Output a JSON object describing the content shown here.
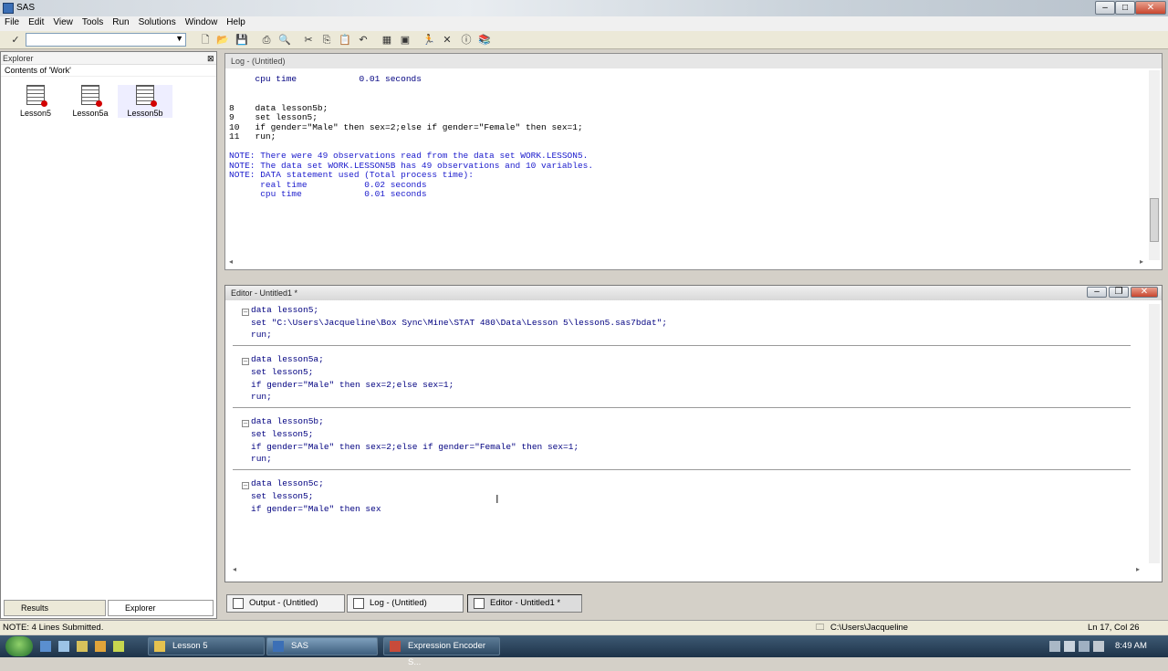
{
  "window": {
    "title": "SAS"
  },
  "menu": [
    "File",
    "Edit",
    "View",
    "Tools",
    "Run",
    "Solutions",
    "Window",
    "Help"
  ],
  "toolbar": {
    "command_value": ""
  },
  "explorer": {
    "title": "Explorer",
    "subtitle": "Contents of 'Work'",
    "items": [
      "Lesson5",
      "Lesson5a",
      "Lesson5b"
    ],
    "tabs": [
      "Results",
      "Explorer"
    ]
  },
  "log": {
    "title": "Log - (Untitled)",
    "lines": [
      {
        "text": "     cpu time            0.01 seconds",
        "color": "#000080"
      },
      {
        "text": "",
        "color": "#000000"
      },
      {
        "text": "",
        "color": "#000000"
      },
      {
        "text": "8    data lesson5b;",
        "color": "#000000"
      },
      {
        "text": "9    set lesson5;",
        "color": "#000000"
      },
      {
        "text": "10   if gender=\"Male\" then sex=2;else if gender=\"Female\" then sex=1;",
        "color": "#000000"
      },
      {
        "text": "11   run;",
        "color": "#000000"
      },
      {
        "text": "",
        "color": "#000000"
      },
      {
        "text": "NOTE: There were 49 observations read from the data set WORK.LESSON5.",
        "color": "#1a1acc"
      },
      {
        "text": "NOTE: The data set WORK.LESSON5B has 49 observations and 10 variables.",
        "color": "#1a1acc"
      },
      {
        "text": "NOTE: DATA statement used (Total process time):",
        "color": "#1a1acc"
      },
      {
        "text": "      real time           0.02 seconds",
        "color": "#1a1acc"
      },
      {
        "text": "      cpu time            0.01 seconds",
        "color": "#1a1acc"
      }
    ]
  },
  "editor": {
    "title": "Editor - Untitled1 *",
    "blocks": [
      {
        "lines": [
          "data lesson5;",
          "set \"C:\\Users\\Jacqueline\\Box Sync\\Mine\\STAT 480\\Data\\Lesson 5\\lesson5.sas7bdat\";",
          "run;"
        ]
      },
      {
        "lines": [
          "data lesson5a;",
          "set lesson5;",
          "if gender=\"Male\" then sex=2;else sex=1;",
          "run;"
        ]
      },
      {
        "lines": [
          "data lesson5b;",
          "set lesson5;",
          "if gender=\"Male\" then sex=2;else if gender=\"Female\" then sex=1;",
          "run;"
        ]
      },
      {
        "lines": [
          "data lesson5c;",
          "set lesson5;",
          "if gender=\"Male\" then sex"
        ]
      }
    ]
  },
  "window_tabs": [
    "Output - (Untitled)",
    "Log - (Untitled)",
    "Editor - Untitled1 *"
  ],
  "status": {
    "message": "NOTE: 4 Lines Submitted.",
    "path": "C:\\Users\\Jacqueline",
    "position": "Ln 17, Col 26"
  },
  "taskbar": {
    "items": [
      "Lesson 5",
      "SAS",
      "Expression Encoder S..."
    ],
    "time": "8:49 AM"
  },
  "colors": {
    "keyword": "#000080",
    "string": "#800080",
    "note": "#1a1acc"
  }
}
